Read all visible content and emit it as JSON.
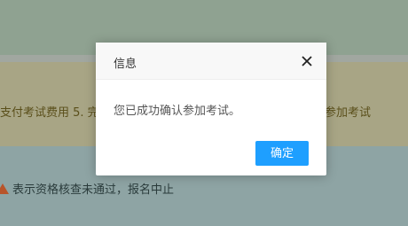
{
  "page": {
    "banner_left_text": "支付考试费用 5. 完",
    "banner_right_text": "参加考试",
    "legend_text": "表示资格核查未通过，报名中止"
  },
  "dialog": {
    "title": "信息",
    "message": "您已成功确认参加考试。",
    "confirm_label": "确定",
    "close_icon": "close-icon"
  },
  "colors": {
    "accent": "#1e9fff",
    "banner": "#a8a585",
    "warning": "#b8542a"
  }
}
